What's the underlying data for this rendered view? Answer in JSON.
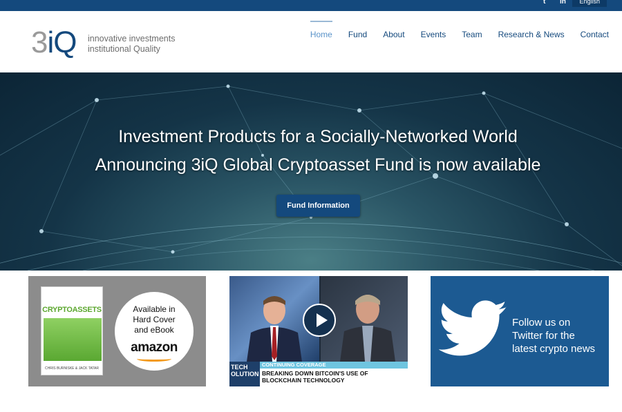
{
  "topbar": {
    "social_icons": [
      "twitter-icon",
      "linkedin-icon"
    ],
    "social_glyphs": [
      "t",
      "in"
    ],
    "language": "English"
  },
  "brand": {
    "logo_three": "3",
    "logo_iq": "iQ",
    "tagline_line1": "innovative investments",
    "tagline_line2": "institutional Quality",
    "colors": {
      "primary": "#14497d",
      "grey": "#9a9a9a",
      "accent": "#5a93c9"
    }
  },
  "nav": {
    "items": [
      {
        "label": "Home",
        "active": true
      },
      {
        "label": "Fund",
        "active": false
      },
      {
        "label": "About",
        "active": false
      },
      {
        "label": "Events",
        "active": false
      },
      {
        "label": "Team",
        "active": false
      },
      {
        "label": "Research & News",
        "active": false
      },
      {
        "label": "Contact",
        "active": false
      }
    ]
  },
  "hero": {
    "headline": "Investment Products for a Socially-Networked World",
    "subheadline": "Announcing 3iQ Global Cryptoasset Fund is now available",
    "button_label": "Fund Information"
  },
  "promo_book": {
    "book_title": "CRYPTOASSETS",
    "book_authors": "CHRIS BURNISKE & JACK TATAR",
    "availability_line1": "Available in",
    "availability_line2": "Hard Cover",
    "availability_line3": "and eBook",
    "retailer": "amazon"
  },
  "promo_video": {
    "ticker_tag_line1": "TECH",
    "ticker_tag_line2": "OLUTION",
    "ticker_label": "CONTINUING COVERAGE",
    "headline_line1": "BREAKING DOWN BITCOIN'S USE OF",
    "headline_line2": "BLOCKCHAIN TECHNOLOGY"
  },
  "promo_twitter": {
    "line1": "Follow us on",
    "line2": "Twitter for the",
    "line3": "latest crypto news"
  }
}
